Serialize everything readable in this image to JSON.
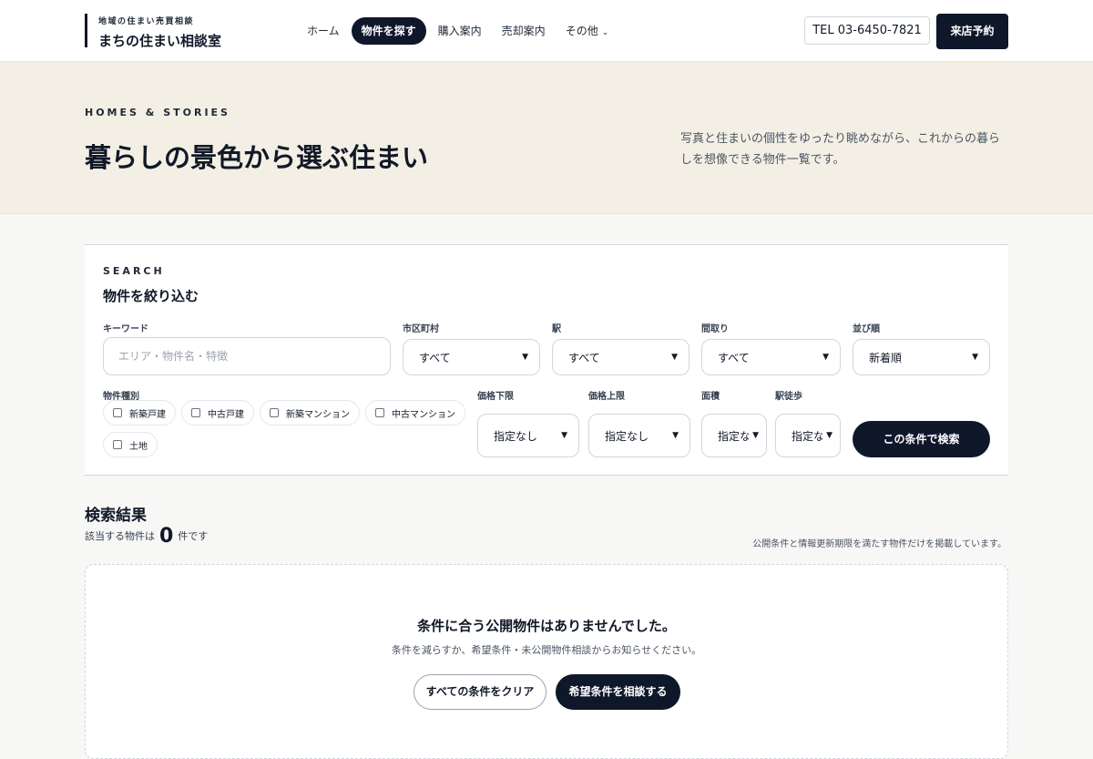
{
  "header": {
    "logo_sub": "地域の住まい売買相談",
    "logo_main": "まちの住まい相談室",
    "nav": [
      {
        "label": "ホーム",
        "active": false
      },
      {
        "label": "物件を探す",
        "active": true
      },
      {
        "label": "購入案内",
        "active": false
      },
      {
        "label": "売却案内",
        "active": false
      },
      {
        "label": "その他",
        "active": false
      }
    ],
    "tel": "TEL 03-6450-7821",
    "reserve_label": "来店予約"
  },
  "hero": {
    "kicker": "HOMES & STORIES",
    "title": "暮らしの景色から選ぶ住まい",
    "description": "写真と住まいの個性をゆったり眺めながら、これからの暮らしを想像できる物件一覧です。"
  },
  "search": {
    "kicker": "SEARCH",
    "title": "物件を絞り込む",
    "keyword": {
      "label": "キーワード",
      "placeholder": "エリア・物件名・特徴",
      "value": ""
    },
    "city": {
      "label": "市区町村",
      "value": "すべて"
    },
    "station": {
      "label": "駅",
      "value": "すべて"
    },
    "layout": {
      "label": "間取り",
      "value": "すべて"
    },
    "sort": {
      "label": "並び順",
      "value": "新着順"
    },
    "property_type": {
      "label": "物件種別",
      "options": [
        {
          "label": "新築戸建",
          "checked": false
        },
        {
          "label": "中古戸建",
          "checked": false
        },
        {
          "label": "新築マンション",
          "checked": false
        },
        {
          "label": "中古マンション",
          "checked": false
        },
        {
          "label": "土地",
          "checked": false
        }
      ]
    },
    "price_min": {
      "label": "価格下限",
      "value": "指定なし"
    },
    "price_max": {
      "label": "価格上限",
      "value": "指定なし"
    },
    "area": {
      "label": "面積",
      "value": "指定なし"
    },
    "walk": {
      "label": "駅徒歩",
      "value": "指定なし"
    },
    "submit_label": "この条件で検索"
  },
  "results": {
    "title": "検索結果",
    "count_prefix": "該当する物件は",
    "count": "0",
    "count_suffix": "件です",
    "note": "公開条件と情報更新期限を満たす物件だけを掲載しています。",
    "empty_title": "条件に合う公開物件はありませんでした。",
    "empty_description": "条件を減らすか、希望条件・未公開物件相談からお知らせください。",
    "clear_label": "すべての条件をクリア",
    "consult_label": "希望条件を相談する"
  }
}
